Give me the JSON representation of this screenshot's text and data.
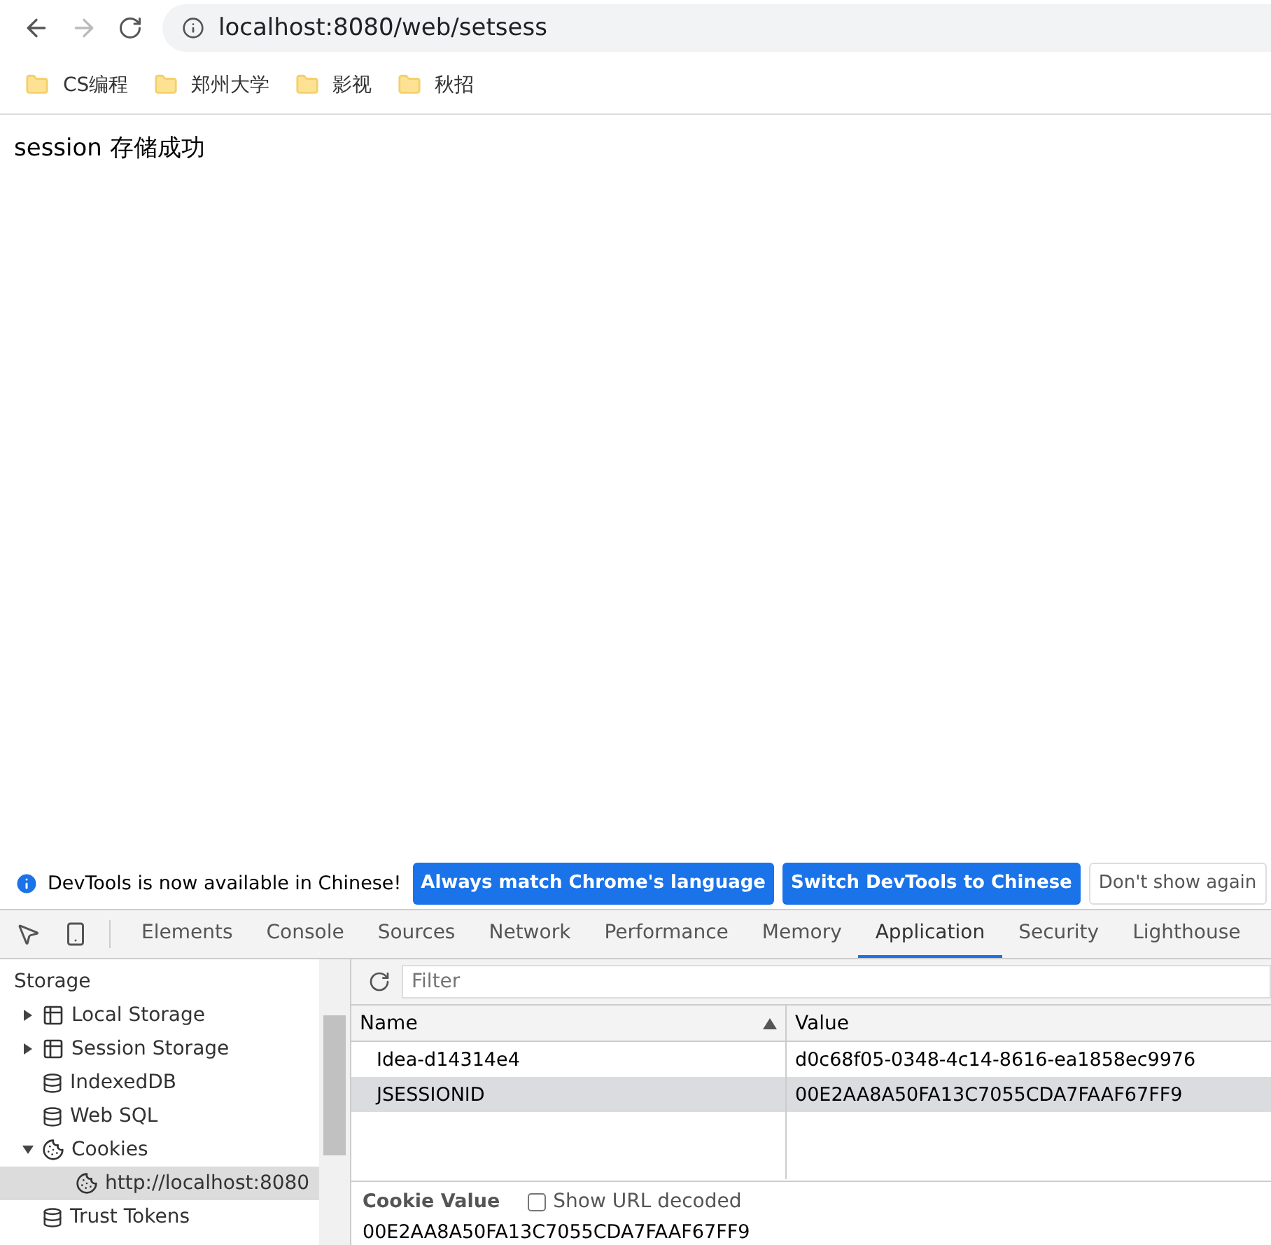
{
  "browser": {
    "address": "localhost:8080/web/setsess",
    "bookmarks": [
      {
        "label": "CS编程"
      },
      {
        "label": "郑州大学"
      },
      {
        "label": "影视"
      },
      {
        "label": "秋招"
      }
    ]
  },
  "page": {
    "message": "session 存储成功"
  },
  "infobar": {
    "text": "DevTools is now available in Chinese!",
    "buttons": [
      {
        "label": "Always match Chrome's language",
        "kind": "primary"
      },
      {
        "label": "Switch DevTools to Chinese",
        "kind": "primary"
      },
      {
        "label": "Don't show again",
        "kind": "plain"
      }
    ]
  },
  "devtools_tabs": [
    {
      "label": "Elements",
      "selected": false
    },
    {
      "label": "Console",
      "selected": false
    },
    {
      "label": "Sources",
      "selected": false
    },
    {
      "label": "Network",
      "selected": false
    },
    {
      "label": "Performance",
      "selected": false
    },
    {
      "label": "Memory",
      "selected": false
    },
    {
      "label": "Application",
      "selected": true
    },
    {
      "label": "Security",
      "selected": false
    },
    {
      "label": "Lighthouse",
      "selected": false
    }
  ],
  "sidebar": {
    "heading": "Storage",
    "items": [
      {
        "label": "Local Storage",
        "kind": "grid",
        "expanded": false,
        "selected": false
      },
      {
        "label": "Session Storage",
        "kind": "grid",
        "expanded": false,
        "selected": false
      },
      {
        "label": "IndexedDB",
        "kind": "db",
        "selected": false
      },
      {
        "label": "Web SQL",
        "kind": "db",
        "selected": false
      },
      {
        "label": "Cookies",
        "kind": "cookie",
        "expanded": true,
        "selected": false,
        "children": [
          {
            "label": "http://localhost:8080",
            "kind": "cookie",
            "selected": true
          }
        ]
      },
      {
        "label": "Trust Tokens",
        "kind": "db",
        "selected": false
      }
    ]
  },
  "filter": {
    "placeholder": "Filter"
  },
  "table": {
    "columns": [
      "Name",
      "Value"
    ],
    "rows": [
      {
        "name": "Idea-d14314e4",
        "value": "d0c68f05-0348-4c14-8616-ea1858ec9976",
        "selected": false
      },
      {
        "name": "JSESSIONID",
        "value": "00E2AA8A50FA13C7055CDA7FAAF67FF9",
        "selected": true
      }
    ]
  },
  "cookie_value": {
    "title": "Cookie Value",
    "decode_label": "Show URL decoded",
    "decode_checked": false,
    "value": "00E2AA8A50FA13C7055CDA7FAAF67FF9"
  }
}
